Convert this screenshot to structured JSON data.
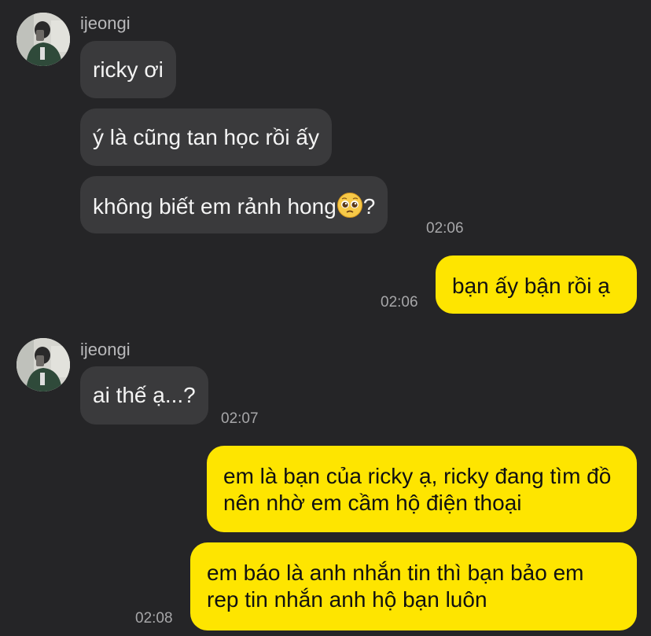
{
  "chat": {
    "sender_name": "ijeongi",
    "messages": [
      {
        "id": "m1",
        "direction": "incoming",
        "text": "ricky ơi"
      },
      {
        "id": "m2",
        "direction": "incoming",
        "text": "ý là cũng tan học rồi ấy"
      },
      {
        "id": "m3",
        "direction": "incoming",
        "text": "không biết em rảnh hong",
        "emoji": "pleading-face-emoji",
        "suffix": "?",
        "time": "02:06"
      },
      {
        "id": "m4",
        "direction": "outgoing",
        "text": "bạn ấy bận rồi ạ",
        "time": "02:06"
      },
      {
        "id": "m5",
        "direction": "incoming",
        "text": "ai thế ạ...?",
        "time": "02:07"
      },
      {
        "id": "m6",
        "direction": "outgoing",
        "text": "em là bạn của ricky ạ, ricky đang tìm đồ nên nhờ em cầm hộ điện thoại"
      },
      {
        "id": "m7",
        "direction": "outgoing",
        "text": "em báo là anh nhắn tin thì bạn bảo em rep tin nhắn anh hộ bạn luôn",
        "time": "02:08"
      }
    ]
  },
  "colors": {
    "background": "#252527",
    "incoming_bubble": "#3a3a3c",
    "outgoing_bubble": "#fee500",
    "timestamp": "#a7a7a9"
  }
}
